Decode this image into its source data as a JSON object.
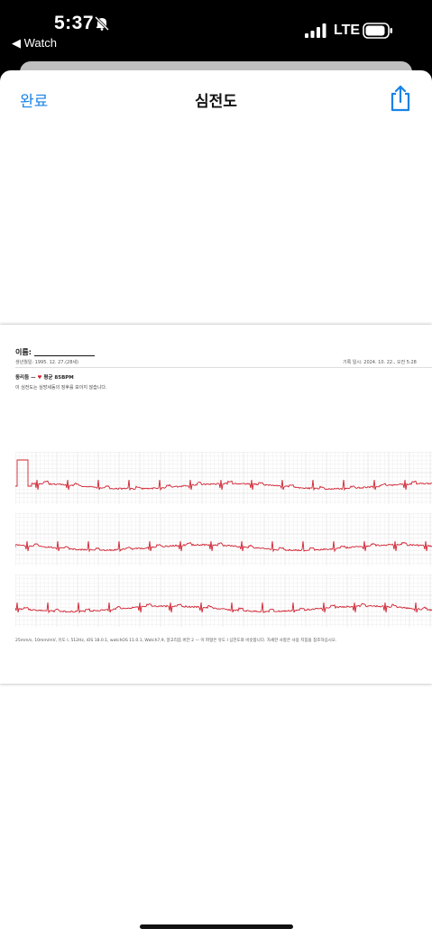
{
  "status_bar": {
    "time": "5:37",
    "back_app": "◀ Watch",
    "carrier": "LTE",
    "icons": [
      "bell-slash-icon",
      "signal-icon",
      "battery-icon"
    ]
  },
  "sheet": {
    "done_label": "완료",
    "title": "심전도",
    "share_icon": "share-icon",
    "accent_color": "#1a82e6"
  },
  "ecg_report": {
    "name_label": "이름:",
    "birth_info": "생년월일: 1995. 12. 27.(28세)",
    "recorded_at": "기록 일시: 2024. 10. 22., 오전 5:28",
    "rhythm": "동리듬 — ",
    "avg_bpm": "평균 85BPM",
    "description": "이 심전도는 심방세동의 징후를 보이지 않습니다.",
    "footer": "25mm/s, 10mm/mV, 유도 I, 512Hz, iOS 18.0.1, watchOS 11.0.1, Watch7,9, 알고리즘 버전 2 — 이 파형은 유도 I 심전도와 비슷합니다. 자세한 사항은 사용 지침을 참조하십시오.",
    "trace_color": "#d0202f"
  }
}
